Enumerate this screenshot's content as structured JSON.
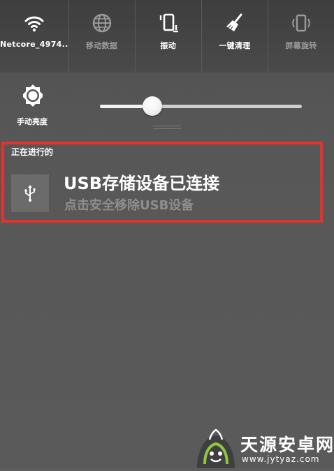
{
  "quick_toggles": [
    {
      "label": "Netcore_4974..",
      "icon": "wifi-icon",
      "state": "on"
    },
    {
      "label": "移动数据",
      "icon": "globe-icon",
      "state": "off"
    },
    {
      "label": "振动",
      "icon": "vibrate-icon",
      "state": "on"
    },
    {
      "label": "一键清理",
      "icon": "broom-icon",
      "state": "on"
    },
    {
      "label": "屏幕旋转",
      "icon": "rotate-screen-icon",
      "state": "off"
    }
  ],
  "brightness": {
    "label": "手动亮度",
    "icon": "brightness-icon",
    "level": 0.26
  },
  "ongoing": {
    "section_title": "正在进行的",
    "notification": {
      "icon": "usb-icon",
      "title": "USB存储设备已连接",
      "subtitle": "点击安全移除USB设备"
    }
  },
  "highlight_color": "#e8312c",
  "watermark": {
    "name": "天源安卓网",
    "url": "www.jytyaz.com"
  }
}
